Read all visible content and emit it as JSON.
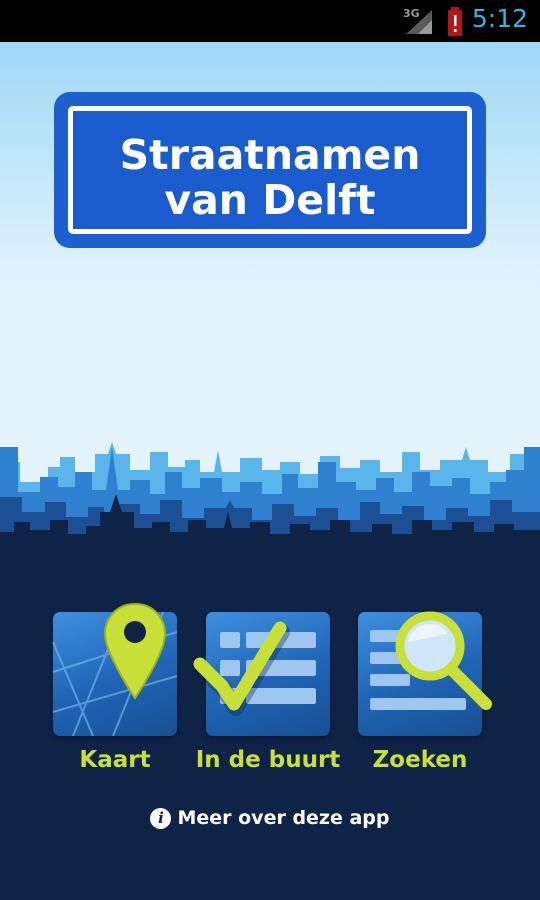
{
  "status_bar": {
    "network": "3G",
    "time": "5:12",
    "icons": [
      "signal-icon",
      "battery-alert-icon"
    ]
  },
  "header": {
    "title_line1": "Straatnamen",
    "title_line2": "van Delft"
  },
  "menu": {
    "items": [
      {
        "label": "Kaart",
        "icon": "map-pin-icon"
      },
      {
        "label": "In de buurt",
        "icon": "checklist-icon"
      },
      {
        "label": "Zoeken",
        "icon": "search-icon"
      }
    ]
  },
  "about": {
    "label": "Meer over deze app",
    "icon": "info-icon",
    "icon_glyph": "i"
  },
  "colors": {
    "accent": "#c8e038",
    "sign_blue": "#1e5fd0",
    "night": "#0f2347",
    "status_clock": "#33b5e5"
  }
}
